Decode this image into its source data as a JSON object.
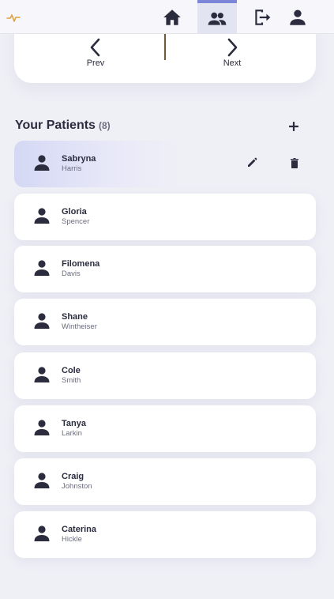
{
  "nav": {
    "logo_icon": "heartbeat-icon",
    "items": [
      {
        "icon": "home-icon",
        "active": false
      },
      {
        "icon": "patients-icon",
        "active": true
      },
      {
        "icon": "logout-icon",
        "active": false
      },
      {
        "icon": "user-icon",
        "active": false
      }
    ],
    "accent": "#7c86d8"
  },
  "pager": {
    "prev_label": "Prev",
    "next_label": "Next"
  },
  "patients_section": {
    "title": "Your Patients",
    "count": "(8)",
    "add_icon": "plus-icon"
  },
  "patients": [
    {
      "first": "Sabryna",
      "last": "Harris",
      "selected": true
    },
    {
      "first": "Gloria",
      "last": "Spencer",
      "selected": false
    },
    {
      "first": "Filomena",
      "last": "Davis",
      "selected": false
    },
    {
      "first": "Shane",
      "last": "Wintheiser",
      "selected": false
    },
    {
      "first": "Cole",
      "last": "Smith",
      "selected": false
    },
    {
      "first": "Tanya",
      "last": "Larkin",
      "selected": false
    },
    {
      "first": "Craig",
      "last": "Johnston",
      "selected": false
    },
    {
      "first": "Caterina",
      "last": "Hickle",
      "selected": false
    }
  ],
  "row_actions": {
    "edit_icon": "pencil-icon",
    "delete_icon": "trash-icon"
  }
}
